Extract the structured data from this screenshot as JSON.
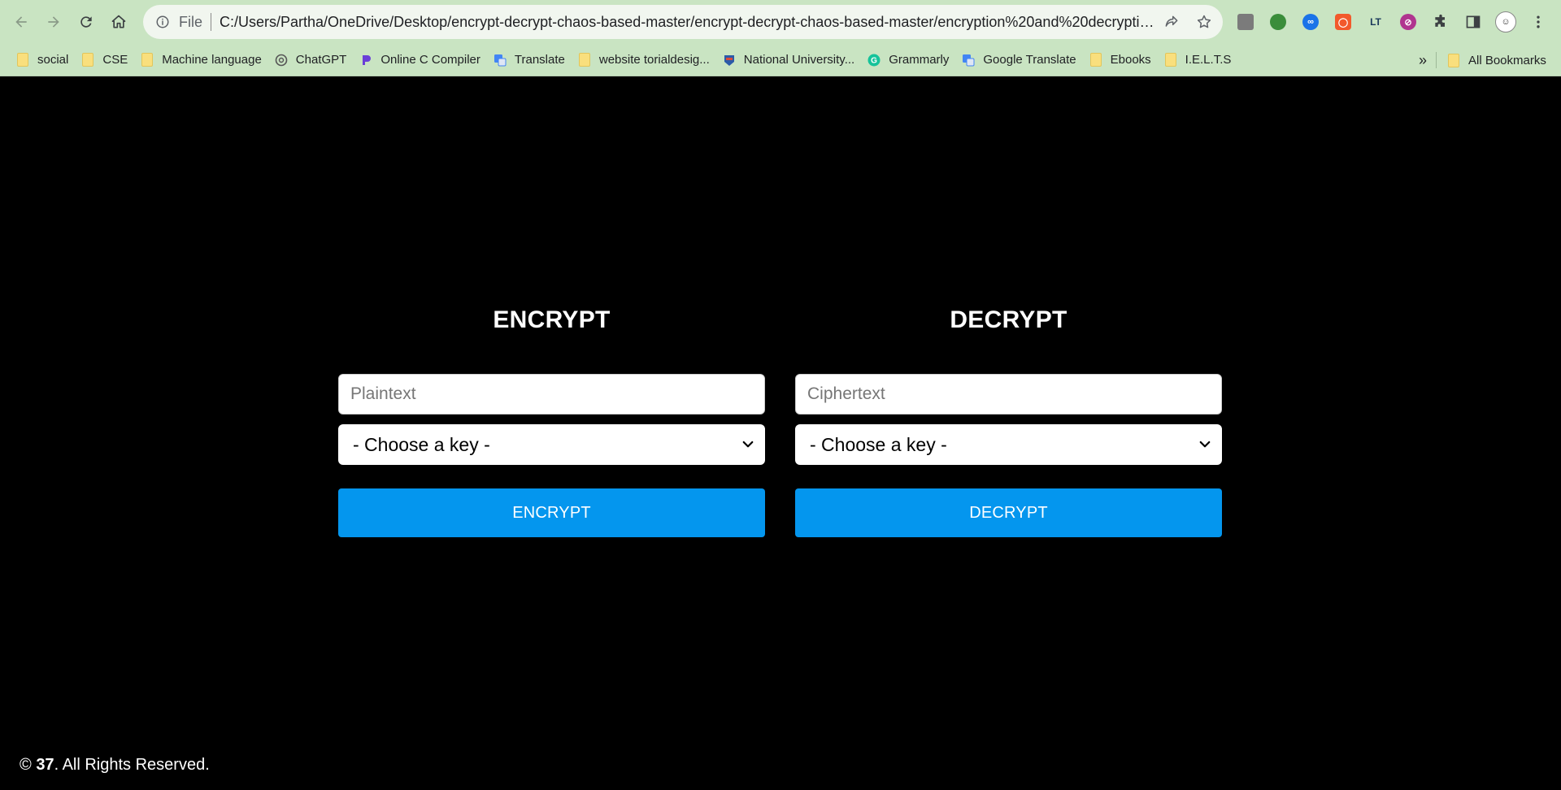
{
  "browser": {
    "omnibox": {
      "scheme": "File",
      "url": "C:/Users/Partha/OneDrive/Desktop/encrypt-decrypt-chaos-based-master/encrypt-decrypt-chaos-based-master/encryption%20and%20decryption..."
    },
    "bookmarks": [
      {
        "label": "social",
        "icon": "folder-icon"
      },
      {
        "label": "CSE",
        "icon": "folder-icon"
      },
      {
        "label": "Machine language",
        "icon": "folder-icon"
      },
      {
        "label": "ChatGPT",
        "icon": "chatgpt-icon"
      },
      {
        "label": "Online C Compiler",
        "icon": "compiler-icon"
      },
      {
        "label": "Translate",
        "icon": "translate-icon"
      },
      {
        "label": "website torialdesig...",
        "icon": "folder-icon"
      },
      {
        "label": "National University...",
        "icon": "university-icon"
      },
      {
        "label": "Grammarly",
        "icon": "grammarly-icon"
      },
      {
        "label": "Google Translate",
        "icon": "translate-icon"
      },
      {
        "label": "Ebooks",
        "icon": "folder-icon"
      },
      {
        "label": "I.E.L.T.S",
        "icon": "folder-icon"
      }
    ],
    "more_bookmarks": "»",
    "all_bookmarks": "All Bookmarks"
  },
  "encrypt": {
    "heading": "ENCRYPT",
    "input_placeholder": "Plaintext",
    "key_select": "- Choose a key -",
    "button": "ENCRYPT"
  },
  "decrypt": {
    "heading": "DECRYPT",
    "input_placeholder": "Ciphertext",
    "key_select": "- Choose a key -",
    "button": "DECRYPT"
  },
  "footer": {
    "copyright_symbol": "©",
    "number": "37",
    "text": ". All Rights Reserved."
  },
  "colors": {
    "toolbar_bg": "#c9e4c2",
    "page_bg": "#000000",
    "button_bg": "#0496ee"
  }
}
